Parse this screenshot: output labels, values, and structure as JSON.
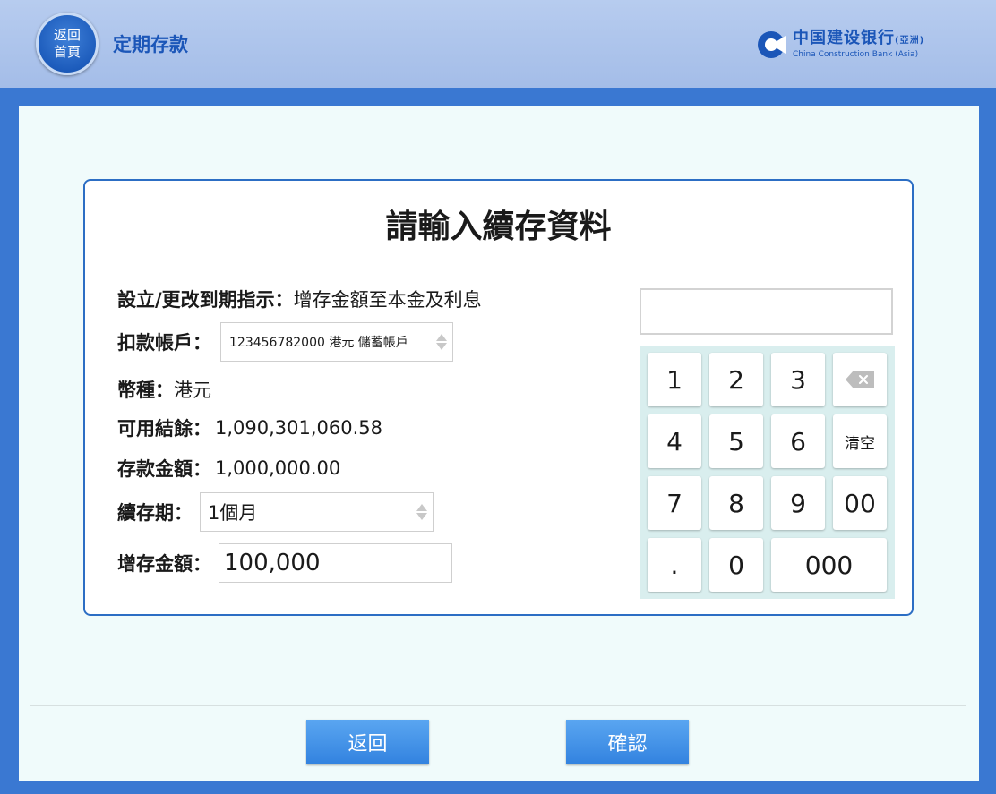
{
  "header": {
    "home_line1": "返回",
    "home_line2": "首頁",
    "title": "定期存款",
    "logo_cn": "中国建设银行",
    "logo_cn_suffix": "(亞洲)",
    "logo_en": "China Construction Bank (Asia)"
  },
  "form": {
    "title": "請輸入續存資料",
    "instruction_label": "設立/更改到期指示：",
    "instruction_value": "增存金額至本金及利息",
    "account_label": "扣款帳戶：",
    "account_value": "123456782000 港元 儲蓄帳戶",
    "currency_label": "幣種：",
    "currency_value": "港元",
    "balance_label": "可用結餘：",
    "balance_value": "1,090,301,060.58",
    "deposit_label": "存款金額：",
    "deposit_value": "1,000,000.00",
    "term_label": "續存期：",
    "term_value": "1個月",
    "add_label": "增存金額：",
    "add_value": "100,000"
  },
  "keypad": {
    "display_value": "",
    "keys": [
      "1",
      "2",
      "3",
      "4",
      "5",
      "6",
      "清空",
      "7",
      "8",
      "9",
      "00",
      ".",
      "0",
      "000"
    ],
    "backspace_icon": "backspace-icon"
  },
  "footer": {
    "back_label": "返回",
    "confirm_label": "確認"
  },
  "colors": {
    "brand": "#1b56b8",
    "button": "#3a8be4",
    "page_bg": "#f0fbfb",
    "frame": "#3a78d2"
  }
}
